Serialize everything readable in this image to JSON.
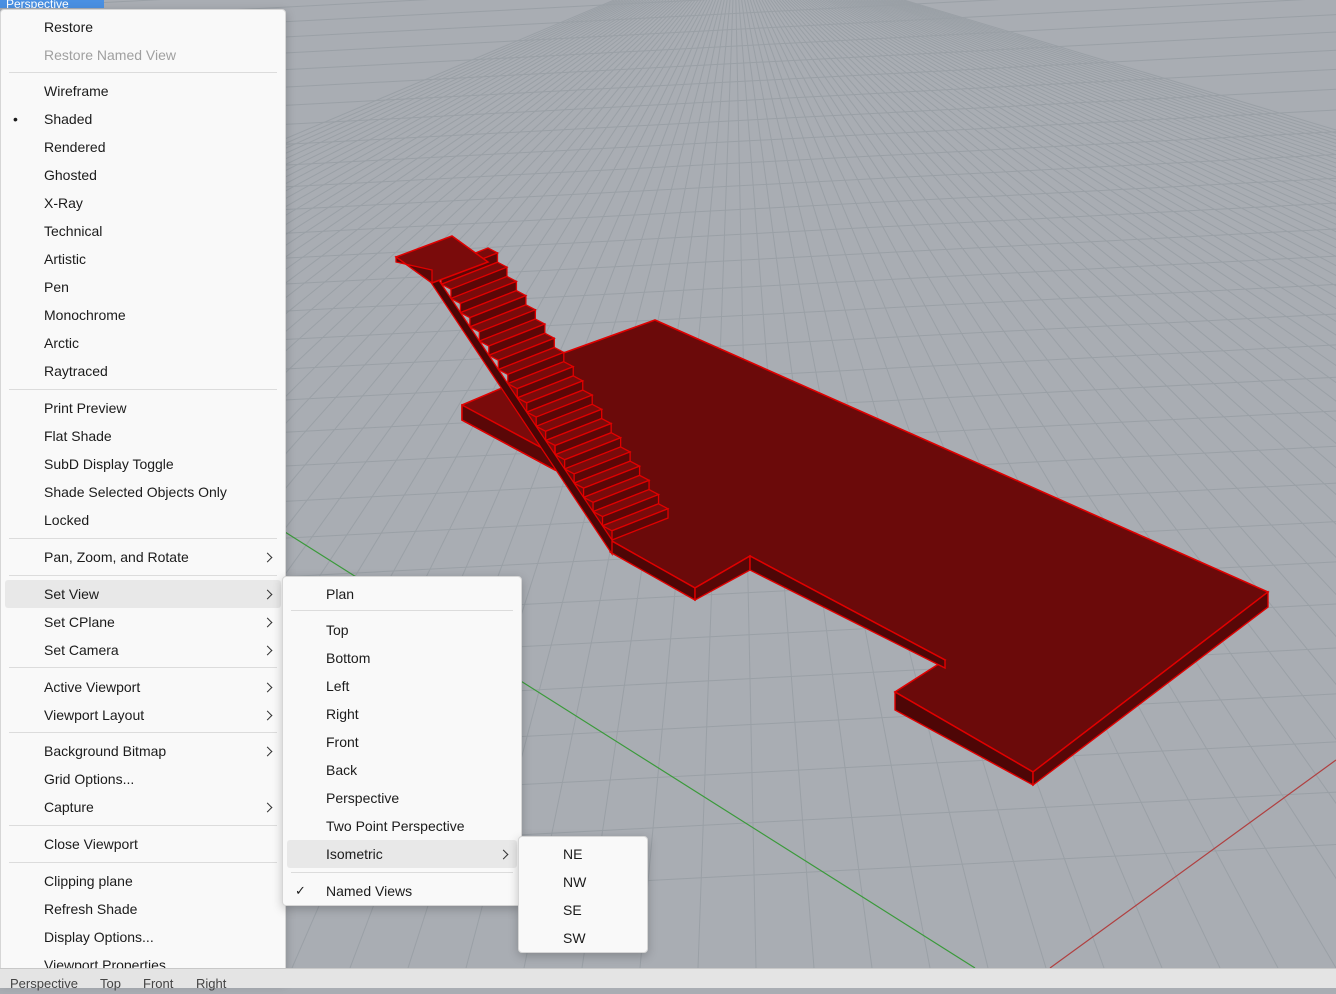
{
  "viewport": {
    "title": "Perspective",
    "background": "#a9adb3",
    "grid_color": "#9aa0a6",
    "model_color": "#6b0a0a",
    "edge_color": "#e00000"
  },
  "main_menu": {
    "items": [
      {
        "label": "Restore"
      },
      {
        "label": "Restore Named View",
        "disabled": true
      },
      {
        "label": "Wireframe"
      },
      {
        "label": "Shaded",
        "bullet": "•"
      },
      {
        "label": "Rendered"
      },
      {
        "label": "Ghosted"
      },
      {
        "label": "X-Ray"
      },
      {
        "label": "Technical"
      },
      {
        "label": "Artistic"
      },
      {
        "label": "Pen"
      },
      {
        "label": "Monochrome"
      },
      {
        "label": "Arctic"
      },
      {
        "label": "Raytraced"
      },
      {
        "label": "Print Preview"
      },
      {
        "label": "Flat Shade"
      },
      {
        "label": "SubD Display Toggle"
      },
      {
        "label": "Shade Selected Objects Only"
      },
      {
        "label": "Locked"
      },
      {
        "label": "Pan, Zoom, and Rotate",
        "submenu": true
      },
      {
        "label": "Set View",
        "submenu": true,
        "highlighted": true
      },
      {
        "label": "Set CPlane",
        "submenu": true
      },
      {
        "label": "Set Camera",
        "submenu": true
      },
      {
        "label": "Active Viewport",
        "submenu": true
      },
      {
        "label": "Viewport Layout",
        "submenu": true
      },
      {
        "label": "Background Bitmap",
        "submenu": true
      },
      {
        "label": "Grid Options..."
      },
      {
        "label": "Capture",
        "submenu": true
      },
      {
        "label": "Close Viewport"
      },
      {
        "label": "Clipping plane"
      },
      {
        "label": "Refresh Shade"
      },
      {
        "label": "Display Options..."
      },
      {
        "label": "Viewport Properties..."
      }
    ]
  },
  "setview_menu": {
    "items": [
      {
        "label": "Plan"
      },
      {
        "label": "Top"
      },
      {
        "label": "Bottom"
      },
      {
        "label": "Left"
      },
      {
        "label": "Right"
      },
      {
        "label": "Front"
      },
      {
        "label": "Back"
      },
      {
        "label": "Perspective"
      },
      {
        "label": "Two Point Perspective"
      },
      {
        "label": "Isometric",
        "submenu": true,
        "highlighted": true
      },
      {
        "label": "Named Views",
        "check": "✓"
      }
    ]
  },
  "iso_menu": {
    "items": [
      {
        "label": "NE"
      },
      {
        "label": "NW"
      },
      {
        "label": "SE"
      },
      {
        "label": "SW"
      }
    ]
  },
  "bottom_tabs": [
    "Perspective",
    "Top",
    "Front",
    "Right"
  ]
}
